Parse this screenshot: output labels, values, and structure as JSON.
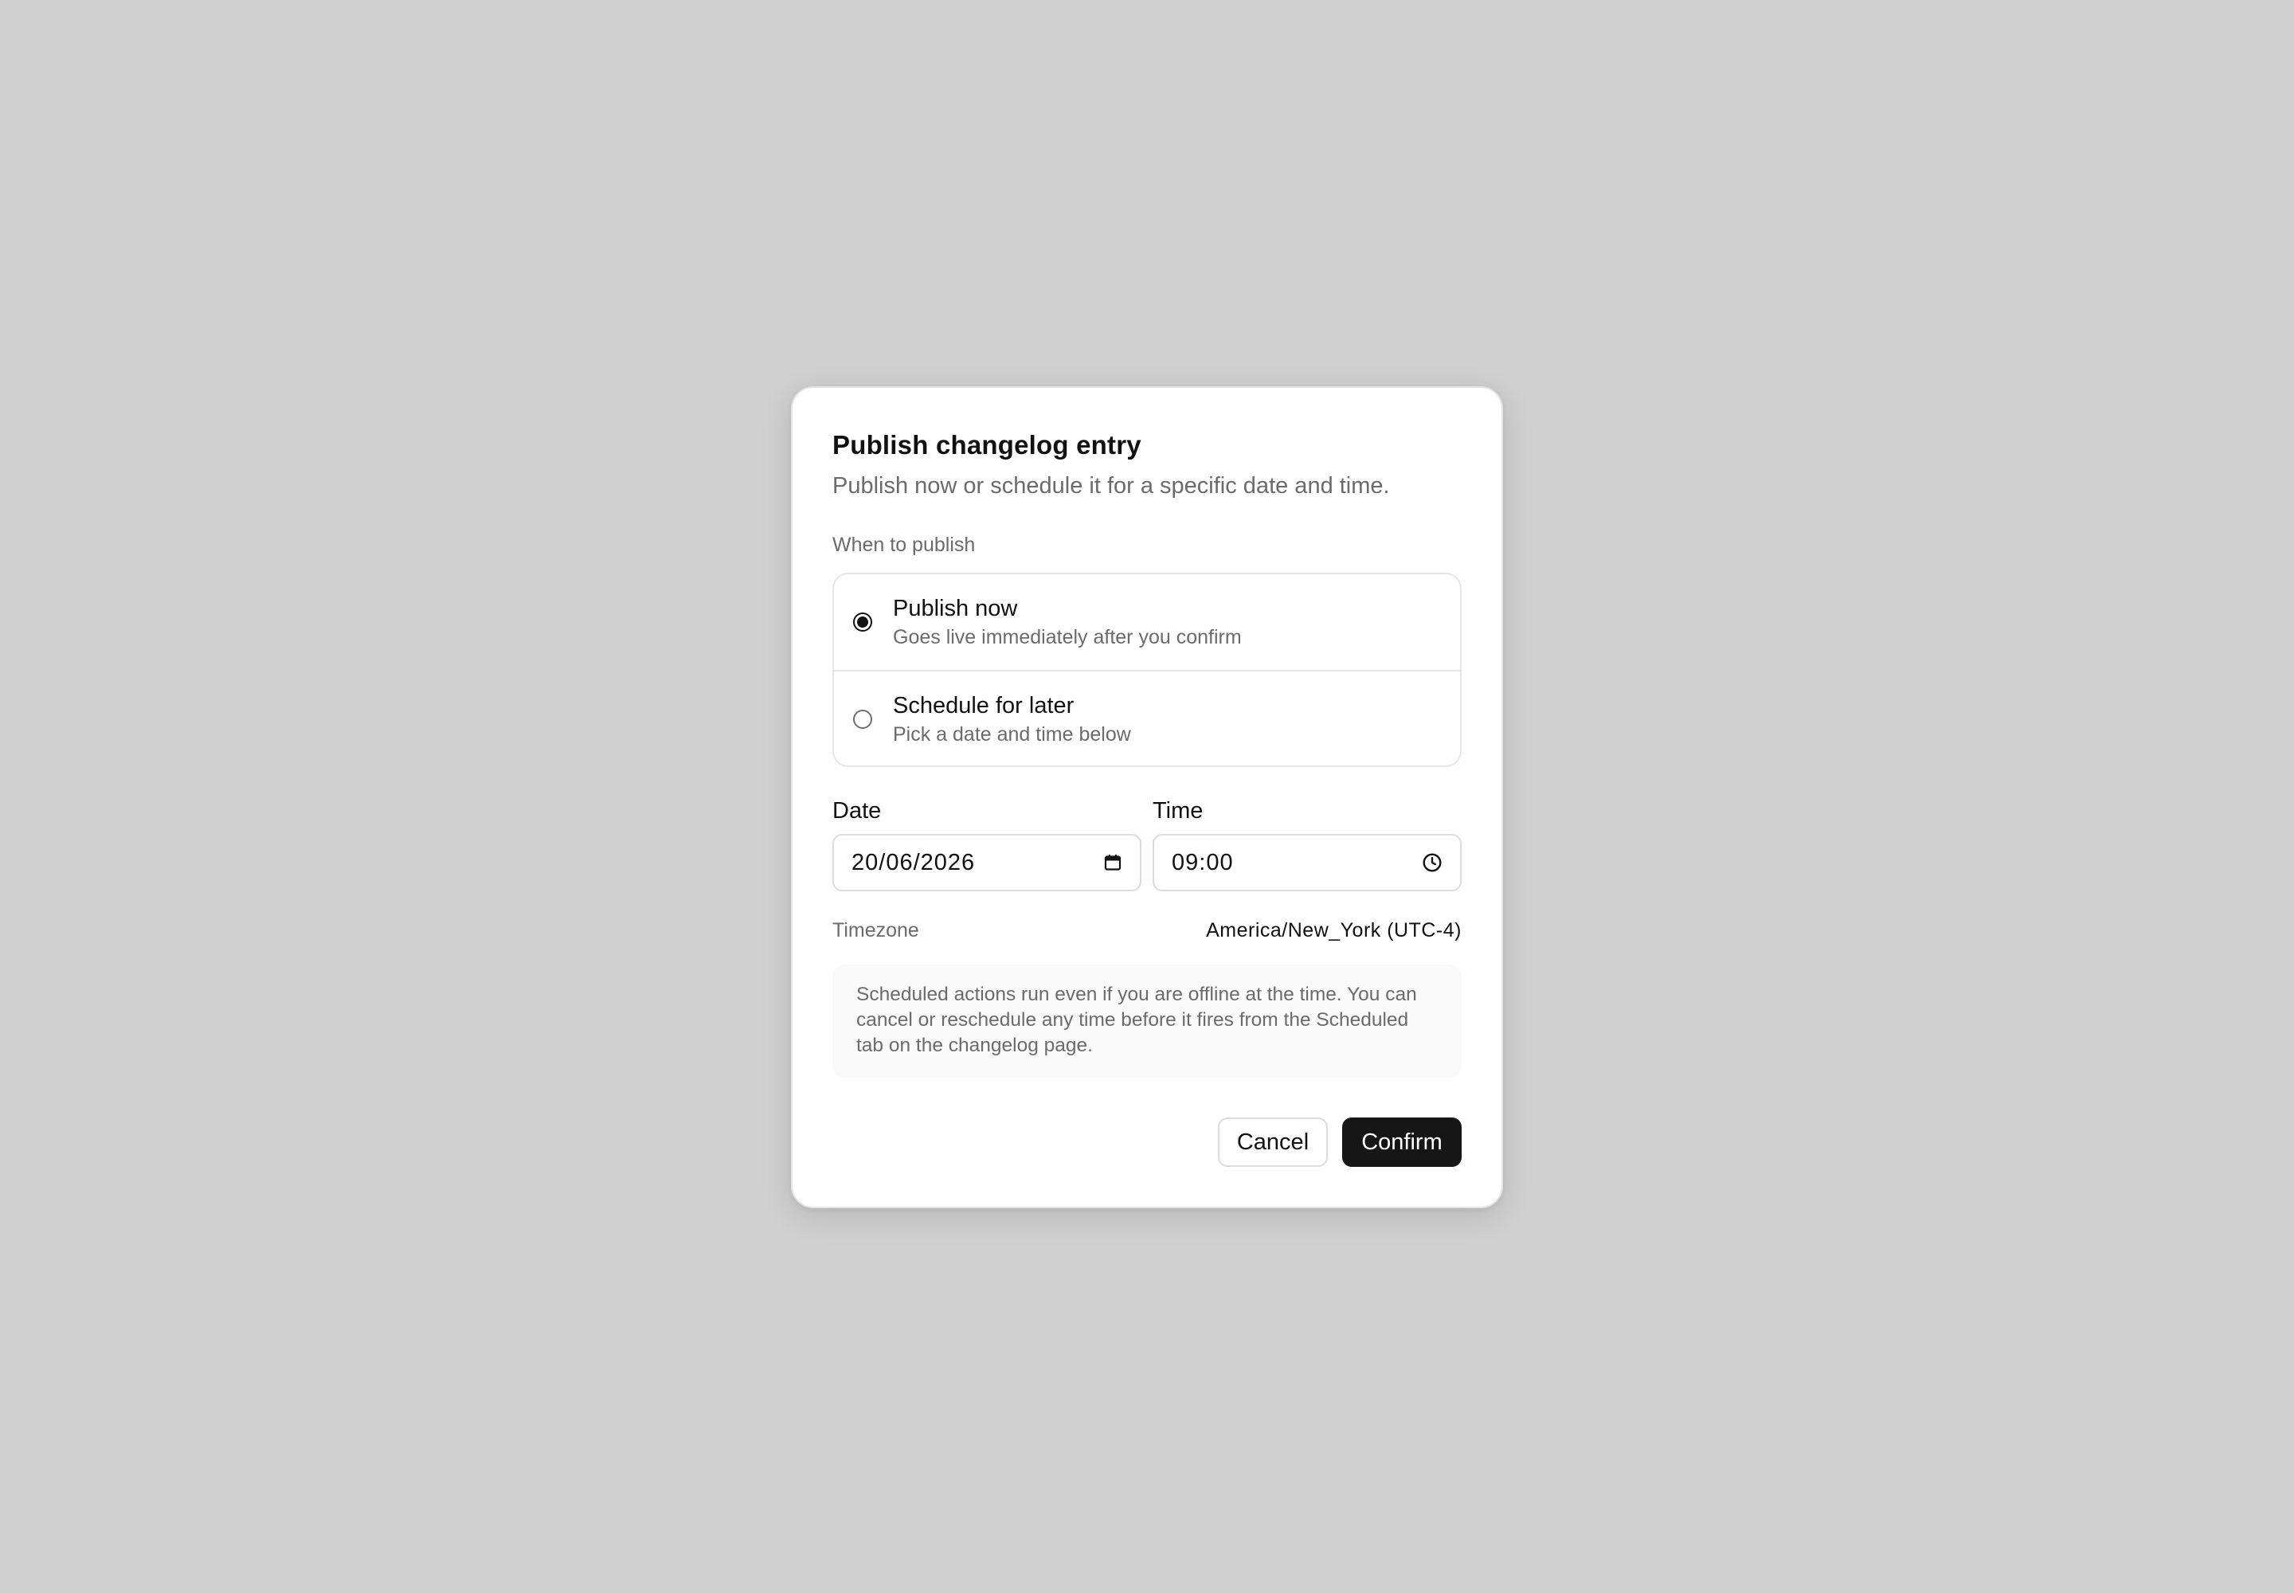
{
  "dialog": {
    "title": "Publish changelog entry",
    "subtitle": "Publish now or schedule it for a specific date and time."
  },
  "publish_timing": {
    "label": "When to publish",
    "selected": "now",
    "options": [
      {
        "id": "now",
        "title": "Publish now",
        "description": "Goes live immediately after you confirm"
      },
      {
        "id": "later",
        "title": "Schedule for later",
        "description": "Pick a date and time below"
      }
    ]
  },
  "date": {
    "label": "Date",
    "value": "20/06/2026",
    "icon": "calendar-icon"
  },
  "time": {
    "label": "Time",
    "value": "09:00",
    "icon": "clock-icon"
  },
  "timezone": {
    "label": "Timezone",
    "value": "America/New_York (UTC-4)"
  },
  "note": {
    "text": "Scheduled actions run even if you are offline at the time. You can cancel or reschedule any time before it fires from the Scheduled tab on the changelog page."
  },
  "actions": {
    "cancel_label": "Cancel",
    "confirm_label": "Confirm"
  },
  "colors": {
    "backdrop": "#d0d0d0",
    "surface": "#ffffff",
    "primary": "#161616",
    "muted_text": "#6b6b6b",
    "border": "#e6e6e6"
  }
}
